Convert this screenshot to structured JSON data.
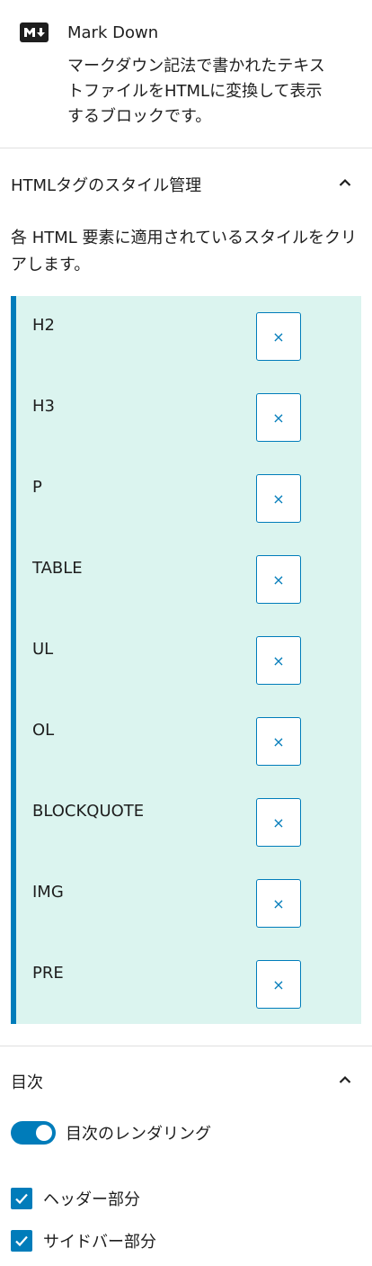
{
  "block": {
    "icon": "markdown-icon",
    "title": "Mark Down",
    "description": "マークダウン記法で書かれたテキストファイルをHTMLに変換して表示するブロックです。"
  },
  "style_panel": {
    "title": "HTMLタグのスタイル管理",
    "toggle_icon": "chevron-up-icon",
    "description": "各 HTML 要素に適用されているスタイルをクリアします。",
    "accent": "#007cba",
    "list_background": "#dbf4ef",
    "clear_label": "×",
    "tags": [
      "H2",
      "H3",
      "P",
      "TABLE",
      "UL",
      "OL",
      "BLOCKQUOTE",
      "IMG",
      "PRE"
    ]
  },
  "toc_panel": {
    "title": "目次",
    "toggle_icon": "chevron-up-icon",
    "render_toggle": {
      "label": "目次のレンダリング",
      "on": true
    },
    "checkboxes": [
      {
        "label": "ヘッダー部分",
        "checked": true
      },
      {
        "label": "サイドバー部分",
        "checked": true
      }
    ]
  }
}
